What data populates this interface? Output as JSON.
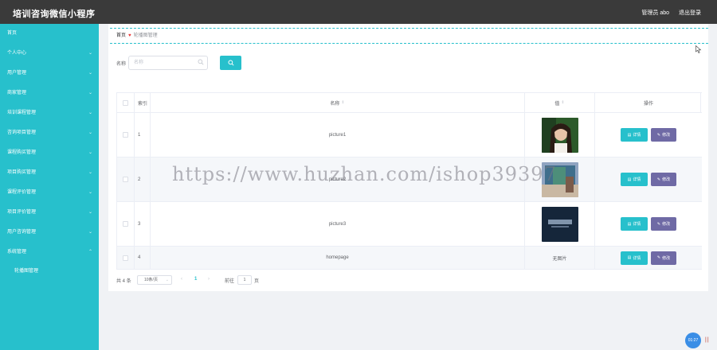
{
  "header": {
    "title": "培训咨询微信小程序",
    "admin": "管理员 abo",
    "logout": "退出登录"
  },
  "sidebar": {
    "items": [
      {
        "label": "首页",
        "chevron": ""
      },
      {
        "label": "个人中心",
        "chevron": "⌄"
      },
      {
        "label": "用户管理",
        "chevron": "⌄"
      },
      {
        "label": "商家管理",
        "chevron": "⌄"
      },
      {
        "label": "培训课程管理",
        "chevron": "⌄"
      },
      {
        "label": "咨询项目管理",
        "chevron": "⌄"
      },
      {
        "label": "课程购买管理",
        "chevron": "⌄"
      },
      {
        "label": "项目购买管理",
        "chevron": "⌄"
      },
      {
        "label": "课程评价管理",
        "chevron": "⌄"
      },
      {
        "label": "项目评价管理",
        "chevron": "⌄"
      },
      {
        "label": "用户咨询管理",
        "chevron": "⌄"
      },
      {
        "label": "系统管理",
        "chevron": "⌃"
      }
    ],
    "subitem": "轮播图管理"
  },
  "breadcrumb": {
    "home": "首页",
    "heart": "♥",
    "current": "轮播图管理"
  },
  "search": {
    "label": "名称",
    "placeholder": "名称"
  },
  "table": {
    "headers": {
      "index": "索引",
      "name": "名称",
      "image": "值",
      "ops": "操作",
      "sort": "⇕"
    },
    "rows": [
      {
        "index": "1",
        "name": "picture1",
        "image_kind": "photo-portrait",
        "image_text": ""
      },
      {
        "index": "2",
        "name": "picture2",
        "image_kind": "photo-room",
        "image_text": ""
      },
      {
        "index": "3",
        "name": "picture3",
        "image_kind": "photo-dark",
        "image_text": ""
      },
      {
        "index": "4",
        "name": "homepage",
        "image_kind": "none",
        "image_text": "无图片"
      }
    ],
    "detail_label": "详情",
    "edit_label": "修改"
  },
  "pagination": {
    "total": "共 4 条",
    "page_size": "10条/页",
    "prev": "‹",
    "current": "1",
    "next": "›",
    "goto": "前往",
    "page_input": "1",
    "unit": "页"
  },
  "watermark": "https://www.huzhan.com/ishop39397",
  "timer": "01:27",
  "bars": "||",
  "colors": {
    "accent": "#27c0cc",
    "topbar": "#3a3a3a",
    "edit": "#6f6aa5"
  }
}
